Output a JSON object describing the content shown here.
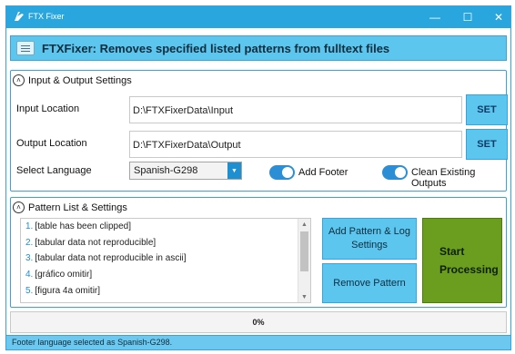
{
  "window": {
    "title": "FTX Fixer",
    "controls": {
      "minimize": "—",
      "maximize": "☐",
      "close": "✕"
    }
  },
  "banner": {
    "heading": "FTXFixer: Removes specified listed patterns from fulltext files"
  },
  "io_settings": {
    "title": "Input & Output Settings",
    "input_label": "Input Location",
    "input_value": "D:\\FTXFixerData\\Input",
    "output_label": "Output Location",
    "output_value": "D:\\FTXFixerData\\Output",
    "set_label": "SET",
    "language_label": "Select Language",
    "language_value": "Spanish-G298",
    "add_footer_label": "Add Footer",
    "add_footer_on": true,
    "clean_outputs_label": "Clean Existing Outputs",
    "clean_outputs_on": true
  },
  "pattern_settings": {
    "title": "Pattern List & Settings",
    "patterns": [
      {
        "num": "1.",
        "text": "[table has been clipped]"
      },
      {
        "num": "2.",
        "text": "[tabular data not reproducible]"
      },
      {
        "num": "3.",
        "text": "[tabular data not reproducible in ascii]"
      },
      {
        "num": "4.",
        "text": "[gráfico omitir]"
      },
      {
        "num": "5.",
        "text": "[figura 4a omitir]"
      }
    ],
    "add_pattern_label": "Add Pattern & Log Settings",
    "remove_pattern_label": "Remove Pattern",
    "start_label_line1": "Start",
    "start_label_line2": "Processing"
  },
  "progress": {
    "value": 0,
    "text": "0%"
  },
  "status": {
    "text": "Footer language selected as Spanish-G298."
  },
  "colors": {
    "accent": "#2aa6de",
    "button": "#5cc6ef",
    "start": "#6b9e1f",
    "toggle": "#2c8fd6"
  }
}
